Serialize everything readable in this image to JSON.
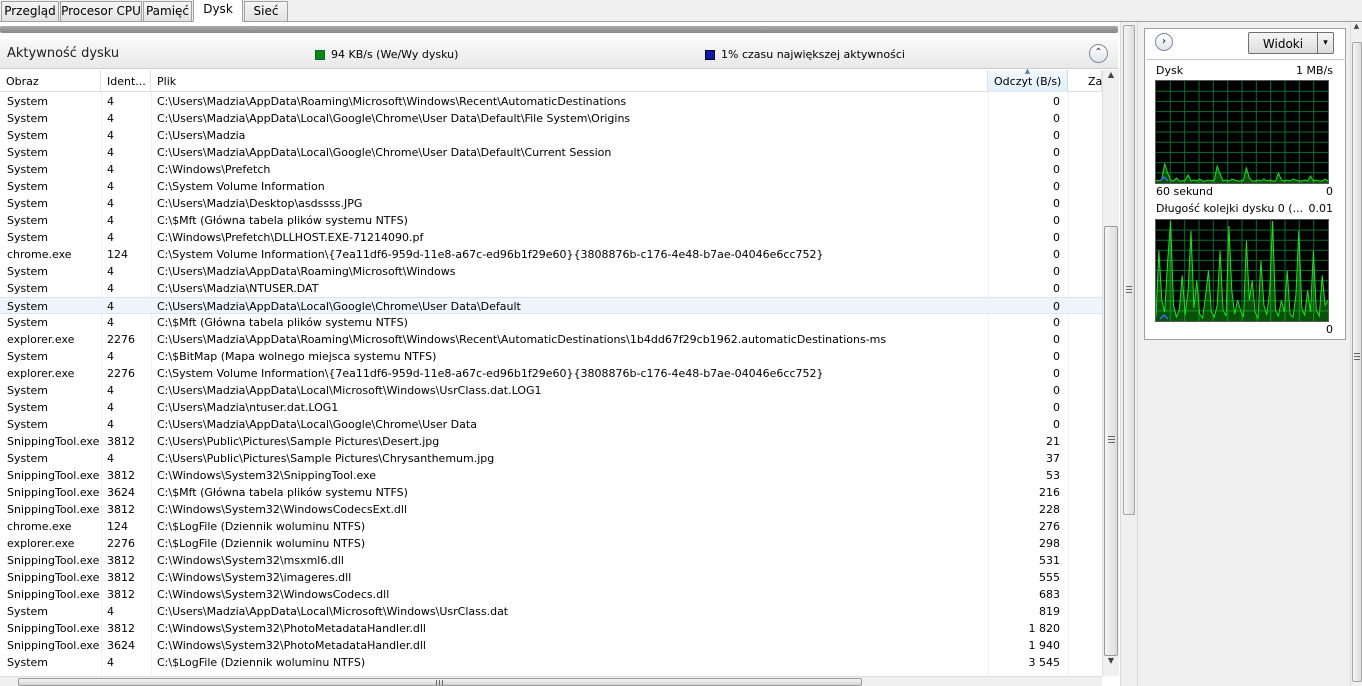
{
  "tabs": [
    "Przegląd",
    "Procesor CPU",
    "Pamięć",
    "Dysk",
    "Sieć"
  ],
  "active_tab": "Dysk",
  "section": {
    "title": "Aktywność dysku",
    "io_text": "94 KB/s (We/Wy dysku)",
    "io_color": "#0c8a0c",
    "activity_text": "1% czasu największej aktywności",
    "activity_color": "#0b1aa8",
    "collapse_glyph": "⌃"
  },
  "columns": {
    "obraz": "Obraz",
    "ident": "Ident...",
    "plik": "Plik",
    "odczyt": "Odczyt (B/s)",
    "zapis": "Za"
  },
  "rows": [
    [
      "System",
      "4",
      "C:\\Users\\Madzia\\AppData\\Roaming\\Microsoft\\Windows\\Recent\\AutomaticDestinations",
      "0"
    ],
    [
      "System",
      "4",
      "C:\\Users\\Madzia\\AppData\\Local\\Google\\Chrome\\User Data\\Default\\File System\\Origins",
      "0"
    ],
    [
      "System",
      "4",
      "C:\\Users\\Madzia",
      "0"
    ],
    [
      "System",
      "4",
      "C:\\Users\\Madzia\\AppData\\Local\\Google\\Chrome\\User Data\\Default\\Current Session",
      "0"
    ],
    [
      "System",
      "4",
      "C:\\Windows\\Prefetch",
      "0"
    ],
    [
      "System",
      "4",
      "C:\\System Volume Information",
      "0"
    ],
    [
      "System",
      "4",
      "C:\\Users\\Madzia\\Desktop\\asdssss.JPG",
      "0"
    ],
    [
      "System",
      "4",
      "C:\\$Mft (Główna tabela plików systemu NTFS)",
      "0"
    ],
    [
      "System",
      "4",
      "C:\\Windows\\Prefetch\\DLLHOST.EXE-71214090.pf",
      "0"
    ],
    [
      "chrome.exe",
      "124",
      "C:\\System Volume Information\\{7ea11df6-959d-11e8-a67c-ed96b1f29e60}{3808876b-c176-4e48-b7ae-04046e6cc752}",
      "0"
    ],
    [
      "System",
      "4",
      "C:\\Users\\Madzia\\AppData\\Roaming\\Microsoft\\Windows",
      "0"
    ],
    [
      "System",
      "4",
      "C:\\Users\\Madzia\\NTUSER.DAT",
      "0"
    ],
    [
      "System",
      "4",
      "C:\\Users\\Madzia\\AppData\\Local\\Google\\Chrome\\User Data\\Default",
      "0"
    ],
    [
      "System",
      "4",
      "C:\\$Mft (Główna tabela plików systemu NTFS)",
      "0"
    ],
    [
      "explorer.exe",
      "2276",
      "C:\\Users\\Madzia\\AppData\\Roaming\\Microsoft\\Windows\\Recent\\AutomaticDestinations\\1b4dd67f29cb1962.automaticDestinations-ms",
      "0"
    ],
    [
      "System",
      "4",
      "C:\\$BitMap (Mapa wolnego miejsca systemu NTFS)",
      "0"
    ],
    [
      "explorer.exe",
      "2276",
      "C:\\System Volume Information\\{7ea11df6-959d-11e8-a67c-ed96b1f29e60}{3808876b-c176-4e48-b7ae-04046e6cc752}",
      "0"
    ],
    [
      "System",
      "4",
      "C:\\Users\\Madzia\\AppData\\Local\\Microsoft\\Windows\\UsrClass.dat.LOG1",
      "0"
    ],
    [
      "System",
      "4",
      "C:\\Users\\Madzia\\ntuser.dat.LOG1",
      "0"
    ],
    [
      "System",
      "4",
      "C:\\Users\\Madzia\\AppData\\Local\\Google\\Chrome\\User Data",
      "0"
    ],
    [
      "SnippingTool.exe",
      "3812",
      "C:\\Users\\Public\\Pictures\\Sample Pictures\\Desert.jpg",
      "21"
    ],
    [
      "System",
      "4",
      "C:\\Users\\Public\\Pictures\\Sample Pictures\\Chrysanthemum.jpg",
      "37"
    ],
    [
      "SnippingTool.exe",
      "3812",
      "C:\\Windows\\System32\\SnippingTool.exe",
      "53"
    ],
    [
      "SnippingTool.exe",
      "3624",
      "C:\\$Mft (Główna tabela plików systemu NTFS)",
      "216"
    ],
    [
      "SnippingTool.exe",
      "3812",
      "C:\\Windows\\System32\\WindowsCodecsExt.dll",
      "228"
    ],
    [
      "chrome.exe",
      "124",
      "C:\\$LogFile (Dziennik woluminu NTFS)",
      "276"
    ],
    [
      "explorer.exe",
      "2276",
      "C:\\$LogFile (Dziennik woluminu NTFS)",
      "298"
    ],
    [
      "SnippingTool.exe",
      "3812",
      "C:\\Windows\\System32\\msxml6.dll",
      "531"
    ],
    [
      "SnippingTool.exe",
      "3812",
      "C:\\Windows\\System32\\imageres.dll",
      "555"
    ],
    [
      "SnippingTool.exe",
      "3812",
      "C:\\Windows\\System32\\WindowsCodecs.dll",
      "683"
    ],
    [
      "System",
      "4",
      "C:\\Users\\Madzia\\AppData\\Local\\Microsoft\\Windows\\UsrClass.dat",
      "819"
    ],
    [
      "SnippingTool.exe",
      "3812",
      "C:\\Windows\\System32\\PhotoMetadataHandler.dll",
      "1 820"
    ],
    [
      "SnippingTool.exe",
      "3624",
      "C:\\Windows\\System32\\PhotoMetadataHandler.dll",
      "1 940"
    ],
    [
      "System",
      "4",
      "C:\\$LogFile (Dziennik woluminu NTFS)",
      "3 545"
    ]
  ],
  "selected_row": 12,
  "right_panel": {
    "nav_glyph": "›",
    "views_button": "Widoki",
    "views_dropdown": "▾",
    "graph1": {
      "title": "Dysk",
      "max": "1 MB/s",
      "footer_left": "60 sekund",
      "footer_right": "0"
    },
    "graph2": {
      "title": "Długość kolejki dysku 0 (...",
      "max": "0.01",
      "footer_right": "0"
    },
    "graph_line_color": "#19e619",
    "graph_grid_color": "#0a6f2b"
  },
  "graph1_series": [
    2,
    1,
    3,
    18,
    9,
    2,
    1,
    4,
    1,
    1,
    2,
    7,
    1,
    2,
    1,
    3,
    1,
    1,
    2,
    1,
    2,
    16,
    8,
    1,
    2,
    1,
    3,
    2,
    1,
    1,
    2,
    14,
    4,
    1,
    1,
    2,
    1,
    3,
    1,
    2,
    1,
    1,
    9,
    2,
    1,
    2,
    1,
    3,
    2,
    1,
    1,
    2,
    1,
    6,
    1,
    2,
    1,
    1,
    3,
    1
  ],
  "graph2_series": [
    4,
    70,
    20,
    8,
    60,
    100,
    15,
    3,
    10,
    45,
    5,
    30,
    90,
    12,
    40,
    6,
    2,
    25,
    50,
    8,
    3,
    15,
    70,
    10,
    4,
    95,
    30,
    6,
    20,
    10,
    3,
    80,
    20,
    40,
    8,
    2,
    60,
    15,
    5,
    30,
    100,
    10,
    4,
    20,
    8,
    50,
    6,
    3,
    25,
    90,
    12,
    5,
    30,
    8,
    70,
    10,
    4,
    45,
    15,
    20
  ]
}
